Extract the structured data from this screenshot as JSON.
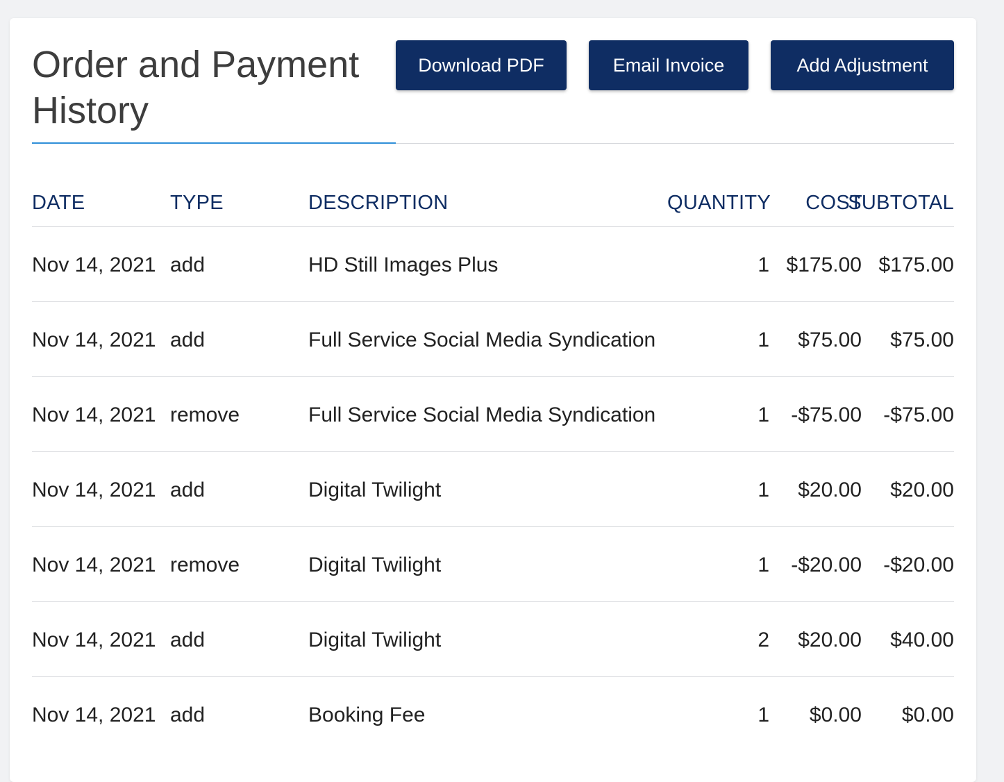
{
  "header": {
    "title": "Order and Payment History",
    "buttons": {
      "download_pdf": "Download PDF",
      "email_invoice": "Email Invoice",
      "add_adjustment": "Add Adjustment"
    }
  },
  "table": {
    "columns": {
      "date": "DATE",
      "type": "TYPE",
      "description": "DESCRIPTION",
      "quantity": "QUANTITY",
      "cost": "COST",
      "subtotal": "SUBTOTAL"
    },
    "rows": [
      {
        "date": "Nov 14, 2021",
        "type": "add",
        "description": "HD Still Images Plus",
        "quantity": "1",
        "cost": "$175.00",
        "subtotal": "$175.00"
      },
      {
        "date": "Nov 14, 2021",
        "type": "add",
        "description": "Full Service Social Media Syndication",
        "quantity": "1",
        "cost": "$75.00",
        "subtotal": "$75.00"
      },
      {
        "date": "Nov 14, 2021",
        "type": "remove",
        "description": "Full Service Social Media Syndication",
        "quantity": "1",
        "cost": "-$75.00",
        "subtotal": "-$75.00"
      },
      {
        "date": "Nov 14, 2021",
        "type": "add",
        "description": "Digital Twilight",
        "quantity": "1",
        "cost": "$20.00",
        "subtotal": "$20.00"
      },
      {
        "date": "Nov 14, 2021",
        "type": "remove",
        "description": "Digital Twilight",
        "quantity": "1",
        "cost": "-$20.00",
        "subtotal": "-$20.00"
      },
      {
        "date": "Nov 14, 2021",
        "type": "add",
        "description": "Digital Twilight",
        "quantity": "2",
        "cost": "$20.00",
        "subtotal": "$40.00"
      },
      {
        "date": "Nov 14, 2021",
        "type": "add",
        "description": "Booking Fee",
        "quantity": "1",
        "cost": "$0.00",
        "subtotal": "$0.00"
      }
    ]
  },
  "colors": {
    "button_bg": "#0f2d63",
    "header_text": "#0f2d63",
    "accent_underline": "#2f8fd8",
    "title_text": "#3d3d3d"
  }
}
